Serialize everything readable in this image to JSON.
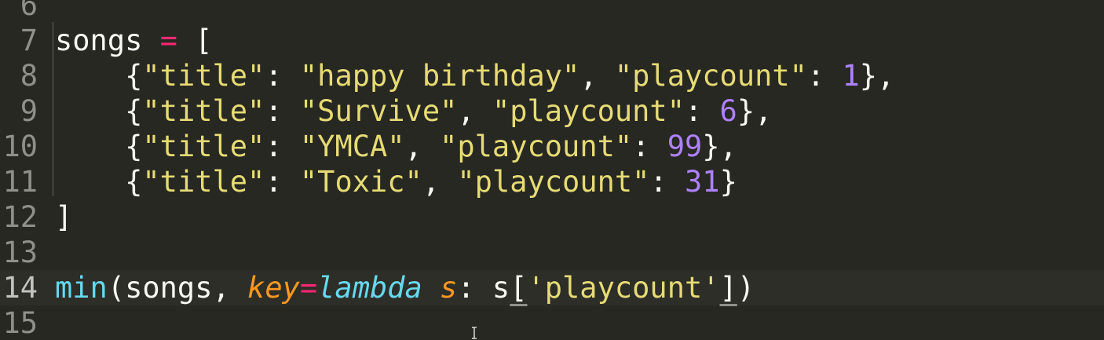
{
  "editor": {
    "lines": [
      {
        "number": "6",
        "segments": []
      },
      {
        "number": "7",
        "segments": [
          {
            "text": "songs ",
            "type": "pl"
          },
          {
            "text": "=",
            "type": "kw"
          },
          {
            "text": " [",
            "type": "pl"
          }
        ]
      },
      {
        "number": "8",
        "segments": [
          {
            "text": "    {",
            "type": "pl"
          },
          {
            "text": "\"title\"",
            "type": "str"
          },
          {
            "text": ": ",
            "type": "pl"
          },
          {
            "text": "\"happy birthday\"",
            "type": "str"
          },
          {
            "text": ", ",
            "type": "pl"
          },
          {
            "text": "\"playcount\"",
            "type": "str"
          },
          {
            "text": ": ",
            "type": "pl"
          },
          {
            "text": "1",
            "type": "num"
          },
          {
            "text": "},",
            "type": "pl"
          }
        ]
      },
      {
        "number": "9",
        "segments": [
          {
            "text": "    {",
            "type": "pl"
          },
          {
            "text": "\"title\"",
            "type": "str"
          },
          {
            "text": ": ",
            "type": "pl"
          },
          {
            "text": "\"Survive\"",
            "type": "str"
          },
          {
            "text": ", ",
            "type": "pl"
          },
          {
            "text": "\"playcount\"",
            "type": "str"
          },
          {
            "text": ": ",
            "type": "pl"
          },
          {
            "text": "6",
            "type": "num"
          },
          {
            "text": "},",
            "type": "pl"
          }
        ]
      },
      {
        "number": "10",
        "segments": [
          {
            "text": "    {",
            "type": "pl"
          },
          {
            "text": "\"title\"",
            "type": "str"
          },
          {
            "text": ": ",
            "type": "pl"
          },
          {
            "text": "\"YMCA\"",
            "type": "str"
          },
          {
            "text": ", ",
            "type": "pl"
          },
          {
            "text": "\"playcount\"",
            "type": "str"
          },
          {
            "text": ": ",
            "type": "pl"
          },
          {
            "text": "99",
            "type": "num"
          },
          {
            "text": "},",
            "type": "pl"
          }
        ]
      },
      {
        "number": "11",
        "segments": [
          {
            "text": "    {",
            "type": "pl"
          },
          {
            "text": "\"title\"",
            "type": "str"
          },
          {
            "text": ": ",
            "type": "pl"
          },
          {
            "text": "\"Toxic\"",
            "type": "str"
          },
          {
            "text": ", ",
            "type": "pl"
          },
          {
            "text": "\"playcount\"",
            "type": "str"
          },
          {
            "text": ": ",
            "type": "pl"
          },
          {
            "text": "31",
            "type": "num"
          },
          {
            "text": "}",
            "type": "pl"
          }
        ]
      },
      {
        "number": "12",
        "segments": [
          {
            "text": "]",
            "type": "pl"
          }
        ]
      },
      {
        "number": "13",
        "segments": []
      },
      {
        "number": "14",
        "current": true,
        "segments": [
          {
            "text": "min",
            "type": "fn"
          },
          {
            "text": "(songs, ",
            "type": "pl"
          },
          {
            "text": "key",
            "type": "param"
          },
          {
            "text": "=",
            "type": "kw"
          },
          {
            "text": "lambda",
            "type": "storage"
          },
          {
            "text": " ",
            "type": "pl"
          },
          {
            "text": "s",
            "type": "param"
          },
          {
            "text": ": s",
            "type": "pl"
          },
          {
            "text": "[",
            "type": "pl",
            "match": true
          },
          {
            "text": "'playcount'",
            "type": "str"
          },
          {
            "text": "]",
            "type": "pl",
            "match": true
          },
          {
            "text": ")",
            "type": "pl"
          }
        ]
      },
      {
        "number": "15",
        "segments": []
      }
    ]
  },
  "colors": {
    "background": "#272822",
    "keyword": "#f92672",
    "string": "#e6db74",
    "number": "#ae81ff",
    "function": "#66d9ef",
    "parameter": "#fd971f"
  },
  "icons": {
    "cursor": "ibeam-cursor-icon"
  }
}
